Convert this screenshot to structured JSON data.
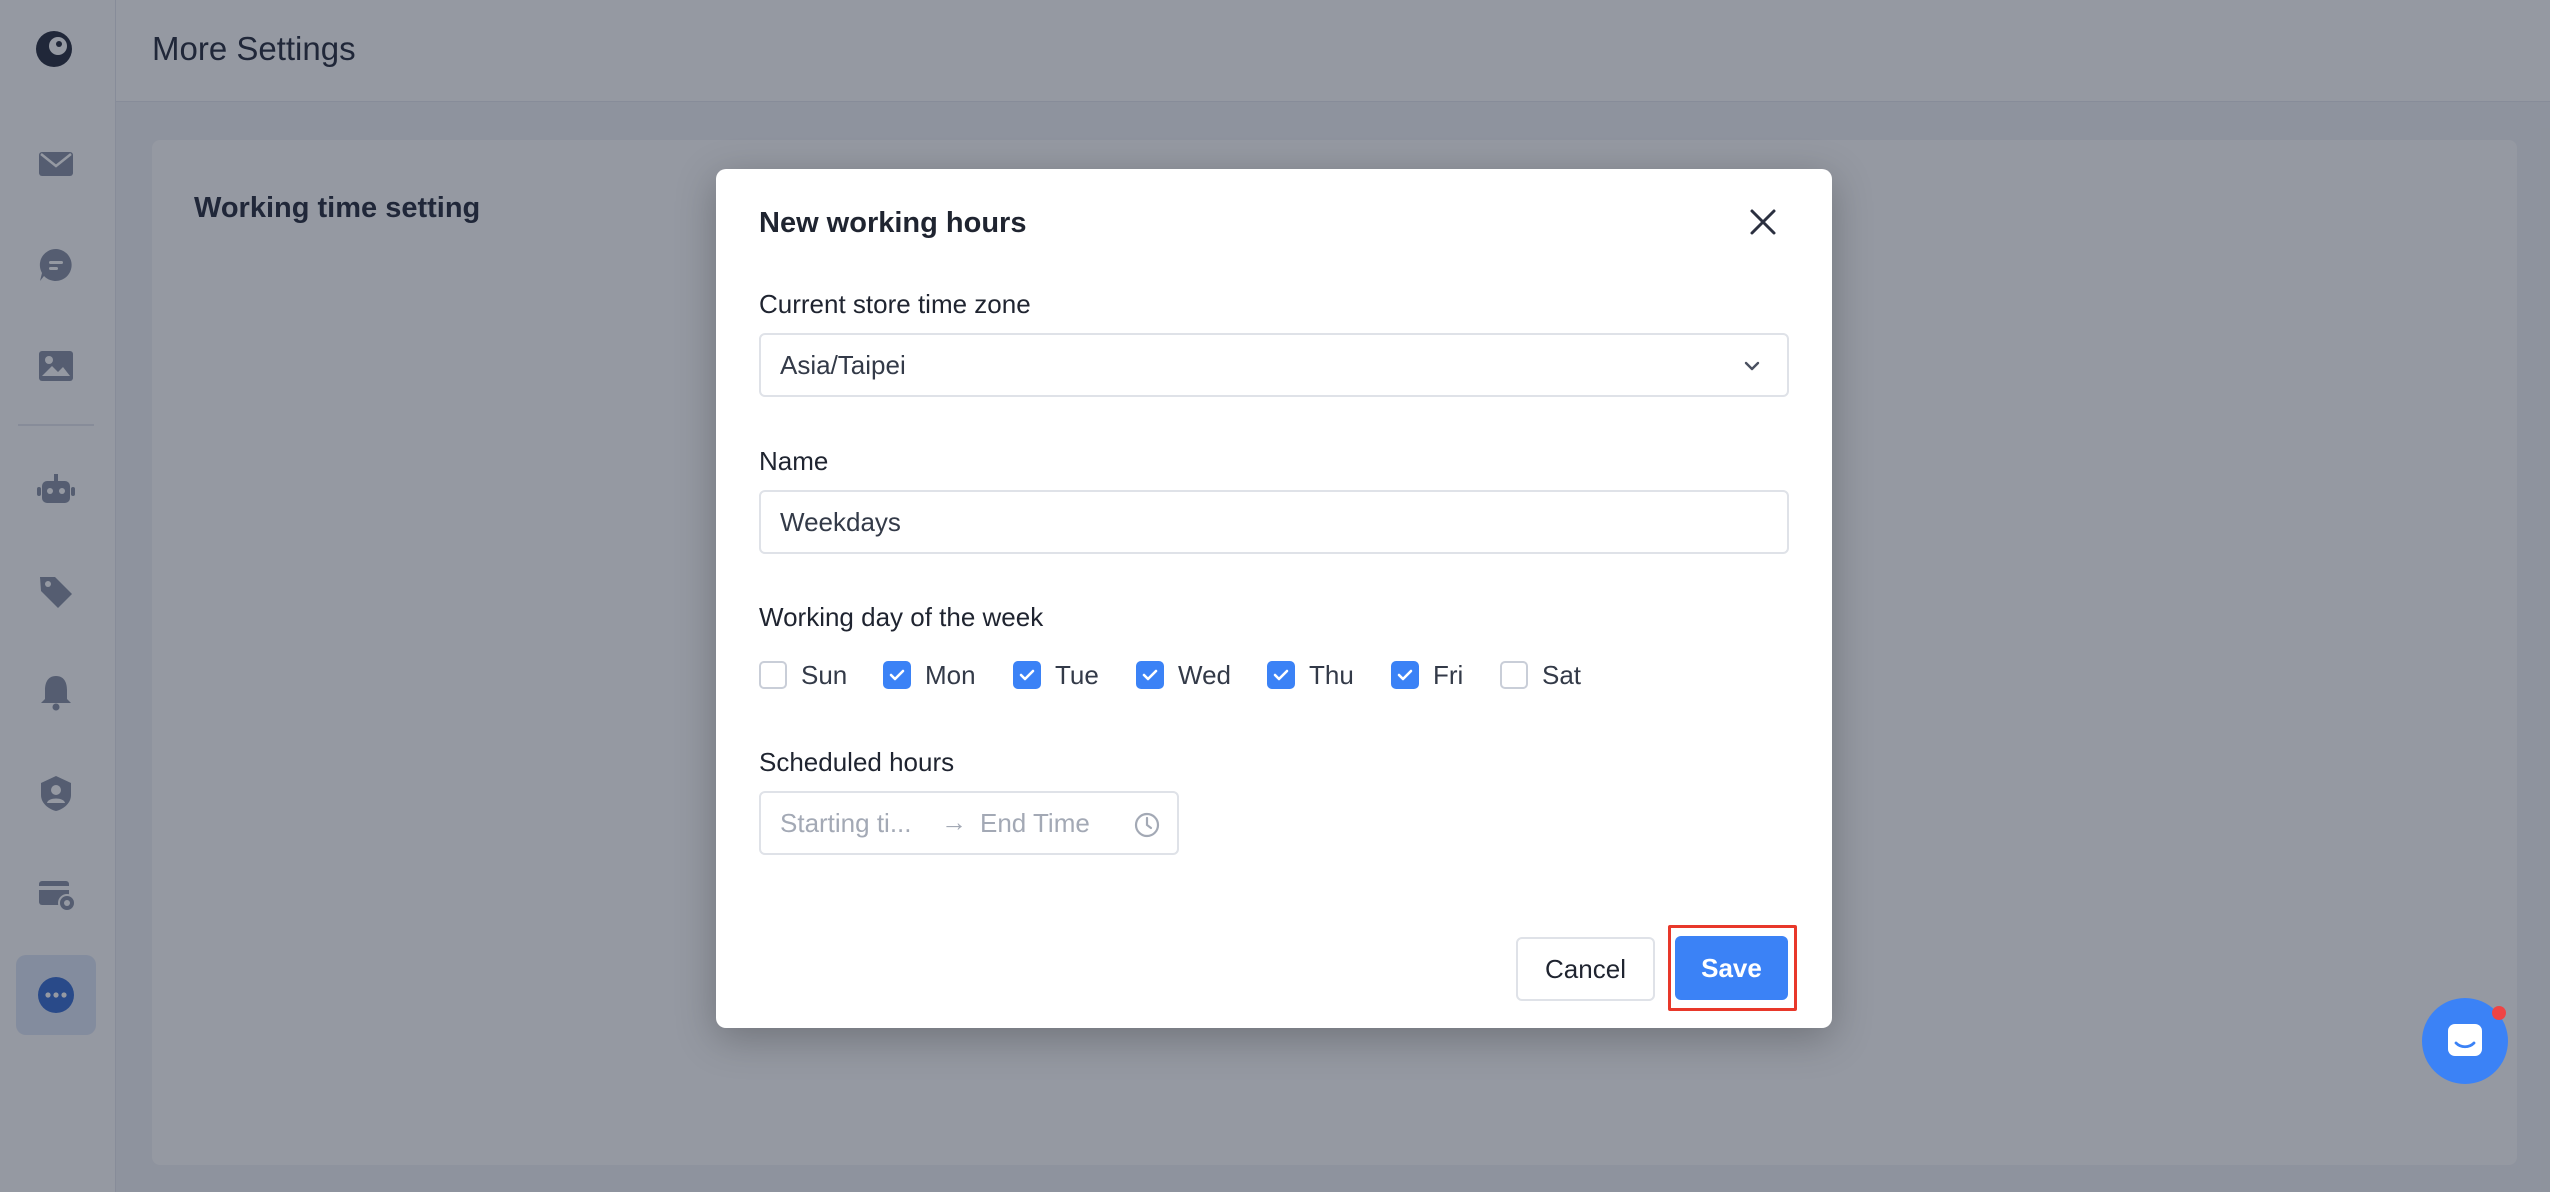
{
  "app": {
    "page_title": "More Settings",
    "section_heading": "Working time setting"
  },
  "sidebar": {
    "items": [
      {
        "icon": "mail-icon",
        "active": false
      },
      {
        "icon": "chat-icon",
        "active": false
      },
      {
        "icon": "image-icon",
        "active": false
      },
      {
        "icon": "robot-icon",
        "active": false
      },
      {
        "icon": "tag-icon",
        "active": false
      },
      {
        "icon": "bell-icon",
        "active": false
      },
      {
        "icon": "user-shield-icon",
        "active": false
      },
      {
        "icon": "card-settings-icon",
        "active": false
      },
      {
        "icon": "more-icon",
        "active": true
      }
    ]
  },
  "modal": {
    "title": "New working hours",
    "timezone_label": "Current store time zone",
    "timezone_value": "Asia/Taipei",
    "name_label": "Name",
    "name_value": "Weekdays",
    "days_label": "Working day of the week",
    "days": [
      {
        "label": "Sun",
        "checked": false
      },
      {
        "label": "Mon",
        "checked": true
      },
      {
        "label": "Tue",
        "checked": true
      },
      {
        "label": "Wed",
        "checked": true
      },
      {
        "label": "Thu",
        "checked": true
      },
      {
        "label": "Fri",
        "checked": true
      },
      {
        "label": "Sat",
        "checked": false
      }
    ],
    "hours_label": "Scheduled hours",
    "start_placeholder": "Starting ti...",
    "end_placeholder": "End Time",
    "range_separator": "→",
    "cancel_label": "Cancel",
    "save_label": "Save"
  },
  "colors": {
    "accent": "#3b82f6",
    "highlight": "#e8382a",
    "overlay": "rgba(20, 28, 48, 0.45)"
  }
}
